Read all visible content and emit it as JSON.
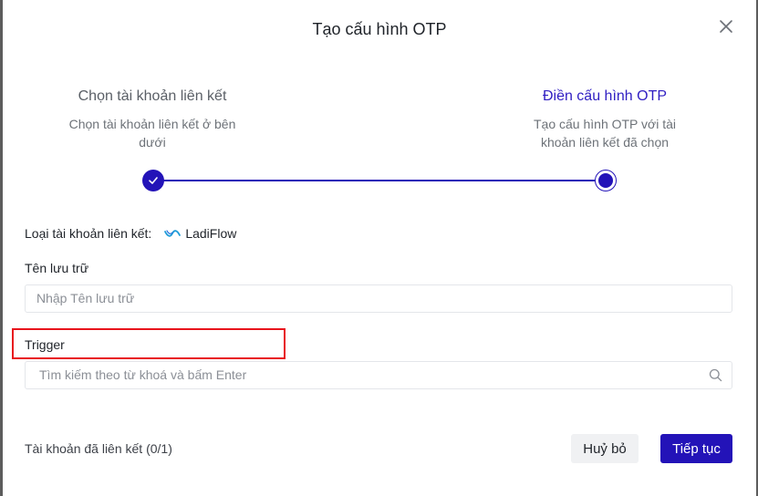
{
  "modal": {
    "title": "Tạo cấu hình OTP"
  },
  "steps": [
    {
      "title": "Chọn tài khoản liên kết",
      "desc_line1": "Chọn tài khoản liên kết ở bên",
      "desc_line2": "dưới",
      "state": "done"
    },
    {
      "title": "Điền cấu hình OTP",
      "desc_line1": "Tạo cấu hình OTP với tài",
      "desc_line2": "khoản liên kết đã chọn",
      "state": "active"
    }
  ],
  "account_type": {
    "label": "Loại tài khoản liên kết:",
    "value": "LadiFlow",
    "icon": "ladiflow-logo-icon"
  },
  "storage_name": {
    "label": "Tên lưu trữ",
    "placeholder": "Nhập Tên lưu trữ"
  },
  "trigger": {
    "label": "Trigger",
    "placeholder": "Tìm kiếm theo từ khoá và bấm Enter"
  },
  "footer": {
    "linked_accounts": "Tài khoản đã liên kết (0/1)",
    "cancel_label": "Huỷ bỏ",
    "next_label": "Tiếp tục"
  },
  "colors": {
    "primary": "#2313b8",
    "active_step": "#2f1ec2",
    "highlight": "#e8141c",
    "overlay": "#5c5c5c"
  }
}
